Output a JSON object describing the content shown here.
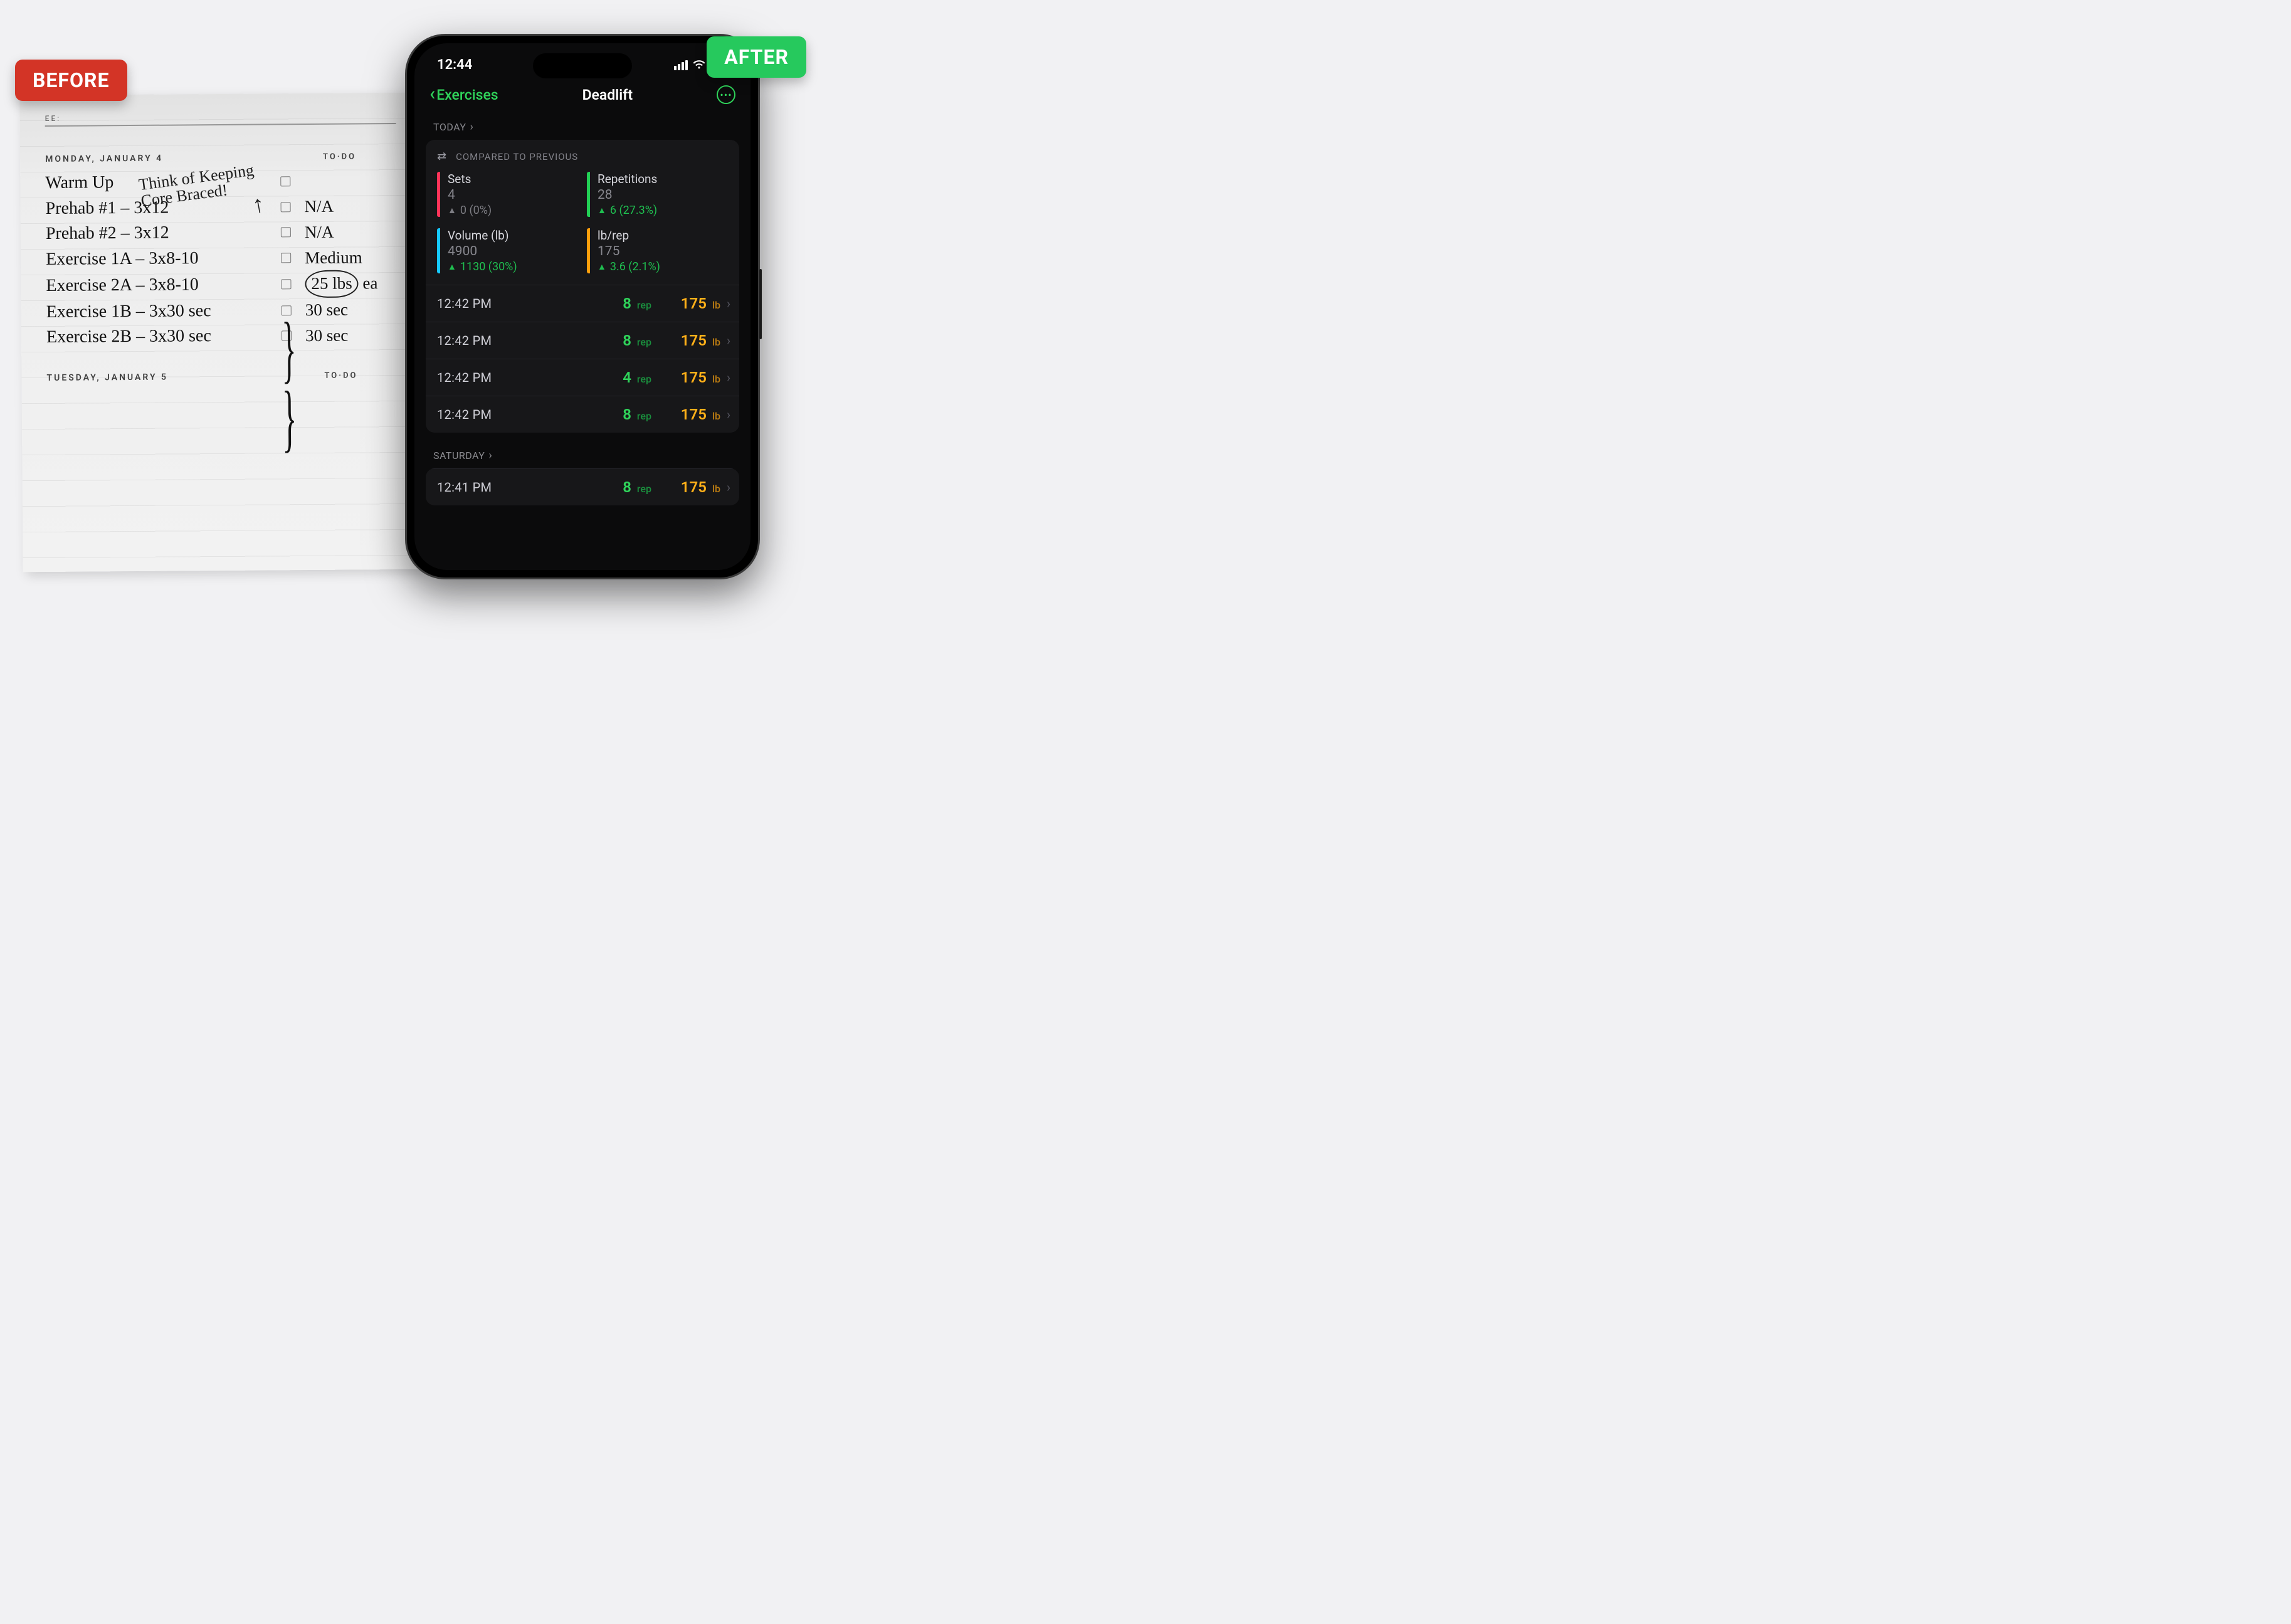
{
  "badges": {
    "before": "BEFORE",
    "after": "AFTER"
  },
  "paper": {
    "header_suffix": "EE:",
    "annotation_line1": "Think of Keeping",
    "annotation_line2": "Core Braced!",
    "days": [
      {
        "label": "MONDAY, JANUARY 4",
        "todo_label": "TO·DO",
        "rows": [
          {
            "lhs": "Warm Up",
            "rhs": ""
          },
          {
            "lhs": "Prehab #1 – 3x12",
            "rhs": "N/A"
          },
          {
            "lhs": "Prehab #2 – 3x12",
            "rhs": "N/A"
          },
          {
            "lhs": "Exercise 1A – 3x8-10",
            "rhs": "Medium"
          },
          {
            "lhs": "Exercise 2A – 3x8-10",
            "rhs": "25 lbs",
            "circled": true,
            "trail": "ea"
          },
          {
            "lhs": "Exercise 1B – 3x30 sec",
            "rhs": "30 sec"
          },
          {
            "lhs": "Exercise 2B – 3x30 sec",
            "rhs": "30 sec"
          }
        ]
      },
      {
        "label": "TUESDAY, JANUARY 5",
        "todo_label": "TO·DO",
        "rows": []
      }
    ]
  },
  "phone": {
    "status_time": "12:44",
    "nav": {
      "back": "Exercises",
      "title": "Deadlift"
    },
    "today_label": "TODAY",
    "compare_label": "COMPARED TO PREVIOUS",
    "stats": [
      {
        "key": "sets",
        "color": "pink",
        "label": "Sets",
        "value": "4",
        "delta": "0 (0%)",
        "dir": "flat"
      },
      {
        "key": "reps",
        "color": "green",
        "label": "Repetitions",
        "value": "28",
        "delta": "6 (27.3%)",
        "dir": "up"
      },
      {
        "key": "volume",
        "color": "cyan",
        "label": "Volume (lb)",
        "value": "4900",
        "delta": "1130 (30%)",
        "dir": "up"
      },
      {
        "key": "lbrep",
        "color": "orange",
        "label": "lb/rep",
        "value": "175",
        "delta": "3.6 (2.1%)",
        "dir": "up"
      }
    ],
    "sets_today": [
      {
        "time": "12:42 PM",
        "reps": "8",
        "rep_unit": "rep",
        "wt": "175",
        "wt_unit": "lb"
      },
      {
        "time": "12:42 PM",
        "reps": "8",
        "rep_unit": "rep",
        "wt": "175",
        "wt_unit": "lb"
      },
      {
        "time": "12:42 PM",
        "reps": "4",
        "rep_unit": "rep",
        "wt": "175",
        "wt_unit": "lb"
      },
      {
        "time": "12:42 PM",
        "reps": "8",
        "rep_unit": "rep",
        "wt": "175",
        "wt_unit": "lb"
      }
    ],
    "saturday_label": "SATURDAY",
    "sets_saturday": [
      {
        "time": "12:41 PM",
        "reps": "8",
        "rep_unit": "rep",
        "wt": "175",
        "wt_unit": "lb"
      }
    ]
  }
}
